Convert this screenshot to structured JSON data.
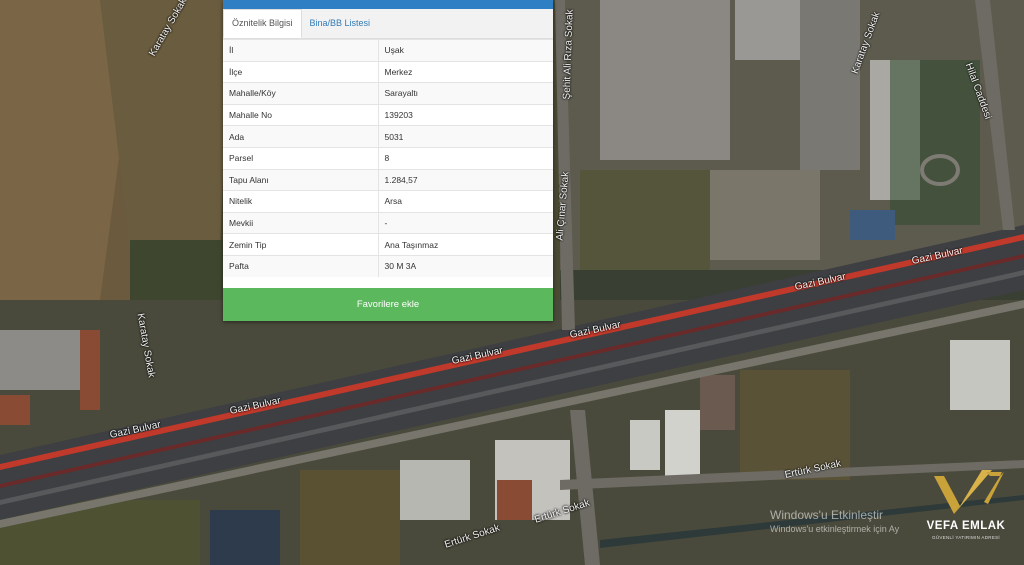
{
  "panel": {
    "tabs": [
      {
        "label": "Öznitelik Bilgisi",
        "active": true
      },
      {
        "label": "Bina/BB Listesi",
        "active": false
      }
    ],
    "rows": [
      {
        "key": "İl",
        "value": "Uşak"
      },
      {
        "key": "İlçe",
        "value": "Merkez"
      },
      {
        "key": "Mahalle/Köy",
        "value": "Sarayaltı"
      },
      {
        "key": "Mahalle No",
        "value": "139203"
      },
      {
        "key": "Ada",
        "value": "5031"
      },
      {
        "key": "Parsel",
        "value": "8"
      },
      {
        "key": "Tapu Alanı",
        "value": "1.284,57"
      },
      {
        "key": "Nitelik",
        "value": "Arsa"
      },
      {
        "key": "Mevkii",
        "value": "-"
      },
      {
        "key": "Zemin Tip",
        "value": "Ana Taşınmaz"
      },
      {
        "key": "Pafta",
        "value": "30 M 3A"
      }
    ],
    "favorite_button": "Favorilere ekle"
  },
  "map_labels": {
    "gazi_1": "Gazi Bulvar",
    "gazi_2": "Gazi Bulvar",
    "gazi_3": "Gazi Bulvar",
    "gazi_4": "Gazi Bulvar",
    "gazi_5": "Gazi Bulvar",
    "gazi_6": "Gazi Bulvar",
    "karatay_1": "Karatay Sokak",
    "karatay_2": "Karatay Sokak",
    "karatay_3": "Karatay Sokak",
    "sehit": "Şehit Ali Rıza Sokak",
    "ali_cinar": "Ali Çınar Sokak",
    "erturk_1": "Ertürk Sokak",
    "erturk_2": "Ertürk Sokak",
    "erturk_3": "Ertürk Sokak",
    "hilal": "Hilal Caddesi"
  },
  "watermark": {
    "line1": "Windows'u Etkinleştir",
    "line2": "Windows'u etkinleştirmek için Ay"
  },
  "logo": {
    "name": "VEFA EMLAK",
    "tagline": "GÜVENLİ YATIRIMIN ADRESİ"
  },
  "colors": {
    "tab_blue": "#2f7fc4",
    "button_green": "#5cb85c",
    "road_red": "#c0392b"
  }
}
